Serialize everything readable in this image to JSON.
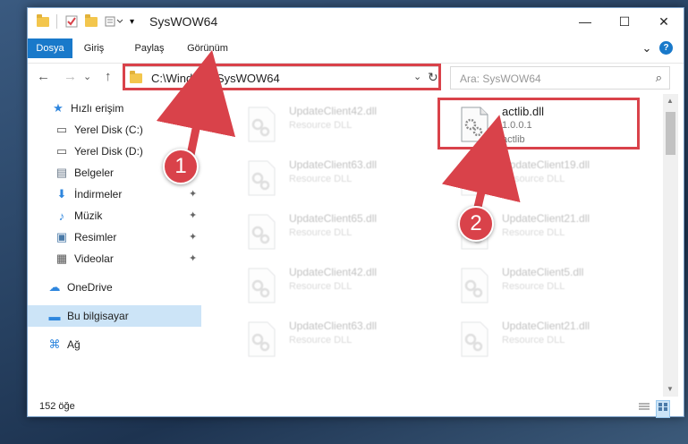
{
  "window": {
    "title": "SysWOW64",
    "controls": {
      "minimize": "—",
      "maximize": "☐",
      "close": "✕"
    }
  },
  "ribbon": {
    "tabs": [
      {
        "label": "Dosya",
        "active": true
      },
      {
        "label": "Giriş"
      },
      {
        "label": "Paylaş"
      },
      {
        "label": "Görünüm"
      }
    ],
    "expand": "⌄",
    "help": "?"
  },
  "nav": {
    "back": "←",
    "forward": "→",
    "recent": "⌄",
    "up": "↑",
    "address": "C:\\Windows\\SysWOW64",
    "address_dropdown": "⌄",
    "refresh": "↻",
    "search_placeholder": "Ara: SysWOW64",
    "search_icon": "⌕"
  },
  "sidebar": {
    "items": [
      {
        "label": "Hızlı erişim",
        "icon": "star-icon",
        "glyph": "★",
        "color": "#2e86de"
      },
      {
        "label": "Yerel Disk (C:)",
        "icon": "drive-icon",
        "glyph": "▭",
        "color": "#555555"
      },
      {
        "label": "Yerel Disk (D:)",
        "icon": "drive-icon",
        "glyph": "▭",
        "color": "#555555"
      },
      {
        "label": "Belgeler",
        "icon": "document-icon",
        "glyph": "▤",
        "color": "#6b7a8a"
      },
      {
        "label": "İndirmeler",
        "icon": "download-icon",
        "glyph": "⬇",
        "color": "#2e86de"
      },
      {
        "label": "Müzik",
        "icon": "music-icon",
        "glyph": "♪",
        "color": "#2e86de"
      },
      {
        "label": "Resimler",
        "icon": "picture-icon",
        "glyph": "▣",
        "color": "#4a7aa8"
      },
      {
        "label": "Videolar",
        "icon": "video-icon",
        "glyph": "▦",
        "color": "#555555"
      },
      {
        "label": "OneDrive",
        "icon": "cloud-icon",
        "glyph": "☁",
        "color": "#2e86de"
      },
      {
        "label": "Bu bilgisayar",
        "icon": "computer-icon",
        "glyph": "▬",
        "color": "#2e86de",
        "selected": true
      },
      {
        "label": "Ağ",
        "icon": "network-icon",
        "glyph": "⌘",
        "color": "#2e86de"
      }
    ],
    "pin_glyph": "📌"
  },
  "files": {
    "highlighted": {
      "name": "actlib.dll",
      "version": "1.0.0.1",
      "desc": "actlib"
    },
    "faded": [
      {
        "name": "UpdateClient42.dll",
        "type": "Resource DLL"
      },
      {
        "name": "UpdateClient63.dll",
        "type": "Resource DLL"
      },
      {
        "name": "UpdateClient19.dll",
        "type": "Resource DLL"
      },
      {
        "name": "UpdateClient65.dll",
        "type": "Resource DLL"
      },
      {
        "name": "UpdateClient21.dll",
        "type": "Resource DLL"
      },
      {
        "name": "UpdateClient42.dll",
        "type": "Resource DLL"
      },
      {
        "name": "UpdateClient5.dll",
        "type": "Resource DLL"
      },
      {
        "name": "UpdateClient63.dll",
        "type": "Resource DLL"
      },
      {
        "name": "UpdateClient21.dll",
        "type": "Resource DLL"
      }
    ]
  },
  "status": {
    "count": "152 öğe"
  },
  "annotations": {
    "step1": "1",
    "step2": "2",
    "color": "#d9424a"
  }
}
